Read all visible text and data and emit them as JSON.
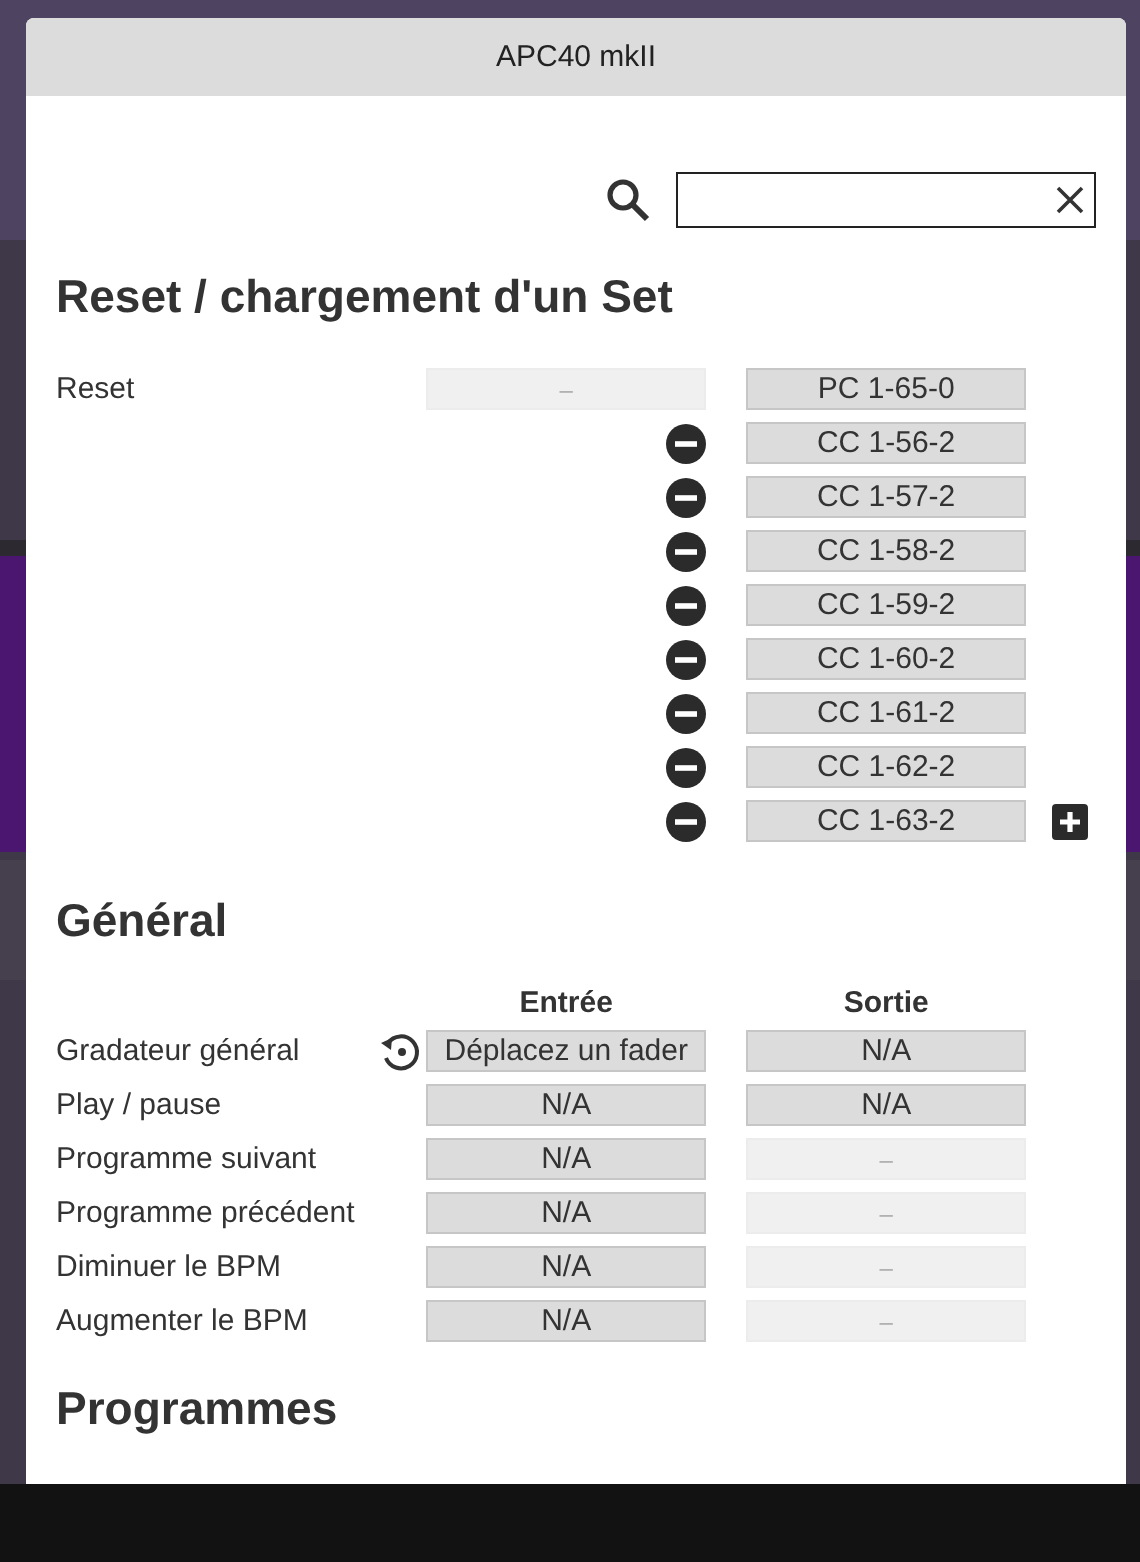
{
  "window": {
    "title": "APC40 mkII"
  },
  "search": {
    "clear_button": true
  },
  "reset_section": {
    "title": "Reset / chargement d'un Set",
    "label": "Reset",
    "input": {
      "text": "–",
      "active": false
    },
    "outputs": [
      {
        "text": "PC 1-65-0",
        "removable": false
      },
      {
        "text": "CC 1-56-2",
        "removable": true
      },
      {
        "text": "CC 1-57-2",
        "removable": true
      },
      {
        "text": "CC 1-58-2",
        "removable": true
      },
      {
        "text": "CC 1-59-2",
        "removable": true
      },
      {
        "text": "CC 1-60-2",
        "removable": true
      },
      {
        "text": "CC 1-61-2",
        "removable": true
      },
      {
        "text": "CC 1-62-2",
        "removable": true
      },
      {
        "text": "CC 1-63-2",
        "removable": true
      }
    ],
    "add_button": true
  },
  "general_section": {
    "title": "Général",
    "columns": [
      "Entrée",
      "Sortie"
    ],
    "rows": [
      {
        "label": "Gradateur général",
        "resettable": true,
        "input": {
          "text": "Déplacez un fader",
          "active": true
        },
        "output": {
          "text": "N/A",
          "active": true
        }
      },
      {
        "label": "Play / pause",
        "resettable": false,
        "input": {
          "text": "N/A",
          "active": true
        },
        "output": {
          "text": "N/A",
          "active": true
        }
      },
      {
        "label": "Programme suivant",
        "resettable": false,
        "input": {
          "text": "N/A",
          "active": true
        },
        "output": {
          "text": "–",
          "active": false
        }
      },
      {
        "label": "Programme précédent",
        "resettable": false,
        "input": {
          "text": "N/A",
          "active": true
        },
        "output": {
          "text": "–",
          "active": false
        }
      },
      {
        "label": "Diminuer le BPM",
        "resettable": false,
        "input": {
          "text": "N/A",
          "active": true
        },
        "output": {
          "text": "–",
          "active": false
        }
      },
      {
        "label": "Augmenter le BPM",
        "resettable": false,
        "input": {
          "text": "N/A",
          "active": true
        },
        "output": {
          "text": "–",
          "active": false
        }
      }
    ]
  },
  "programmes_section": {
    "title": "Programmes"
  }
}
